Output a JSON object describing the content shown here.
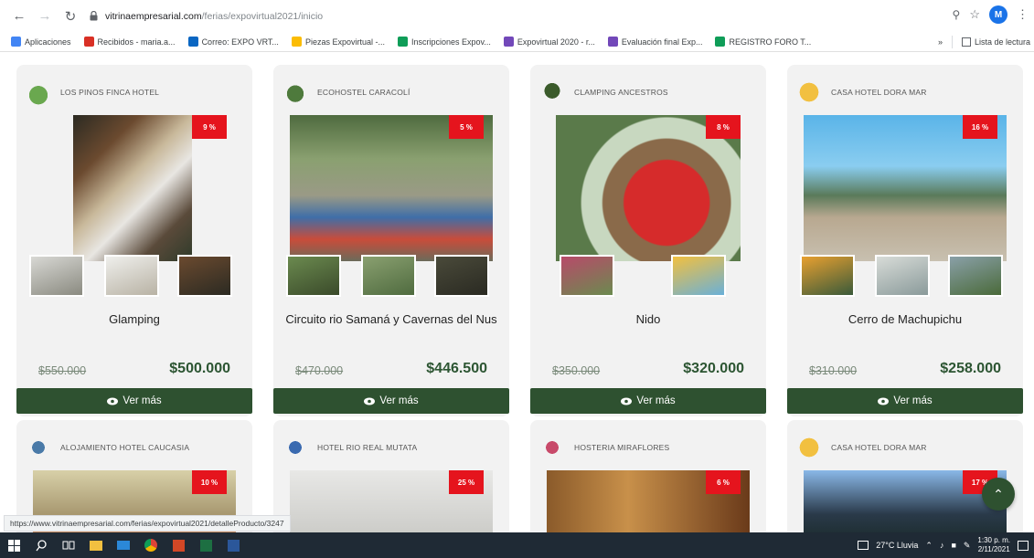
{
  "browser": {
    "url_host": "vitrinaempresarial.com",
    "url_path": "/ferias/expovirtual2021/inicio",
    "avatar": "M",
    "bookmarks": [
      {
        "label": "Aplicaciones",
        "color": "#4285f4"
      },
      {
        "label": "Recibidos - maria.a...",
        "color": "#d93025"
      },
      {
        "label": "Correo: EXPO VRT...",
        "color": "#0a66c2"
      },
      {
        "label": "Piezas Expovirtual -...",
        "color": "#fbbc04"
      },
      {
        "label": "Inscripciones Expov...",
        "color": "#0f9d58"
      },
      {
        "label": "Expovirtual 2020 - r...",
        "color": "#7248b9"
      },
      {
        "label": "Evaluación final Exp...",
        "color": "#7248b9"
      },
      {
        "label": "REGISTRO FORO T...",
        "color": "#0f9d58"
      }
    ],
    "bookmarks_more": "»",
    "reading_list": "Lista de lectura",
    "status_url": "https://www.vitrinaempresarial.com/ferias/expovirtual2021/detalleProducto/3247"
  },
  "cards": [
    {
      "hotel": "LOS PINOS FINCA HOTEL",
      "discount": "9 %",
      "product": "Glamping",
      "old_price": "$550.000",
      "new_price": "$500.000",
      "button": "Ver más"
    },
    {
      "hotel": "ECOHOSTEL CARACOLÍ",
      "discount": "5 %",
      "product": "Circuito rio Samaná y Cavernas del Nus",
      "old_price": "$470.000",
      "new_price": "$446.500",
      "button": "Ver más"
    },
    {
      "hotel": "CLAMPING ANCESTROS",
      "discount": "8 %",
      "product": "Nido",
      "old_price": "$350.000",
      "new_price": "$320.000",
      "button": "Ver más"
    },
    {
      "hotel": "CASA HOTEL DORA MAR",
      "discount": "16 %",
      "product": "Cerro de Machupichu",
      "old_price": "$310.000",
      "new_price": "$258.000",
      "button": "Ver más"
    }
  ],
  "cards_row2": [
    {
      "hotel": "ALOJAMIENTO HOTEL CAUCASIA",
      "discount": "10 %"
    },
    {
      "hotel": "HOTEL RIO REAL MUTATA",
      "discount": "25 %"
    },
    {
      "hotel": "HOSTERIA MIRAFLORES",
      "discount": "6 %"
    },
    {
      "hotel": "CASA HOTEL DORA MAR",
      "discount": "17 %"
    }
  ],
  "taskbar": {
    "weather": "27°C  Lluvia",
    "time": "1:30 p. m.",
    "date": "2/11/2021"
  }
}
